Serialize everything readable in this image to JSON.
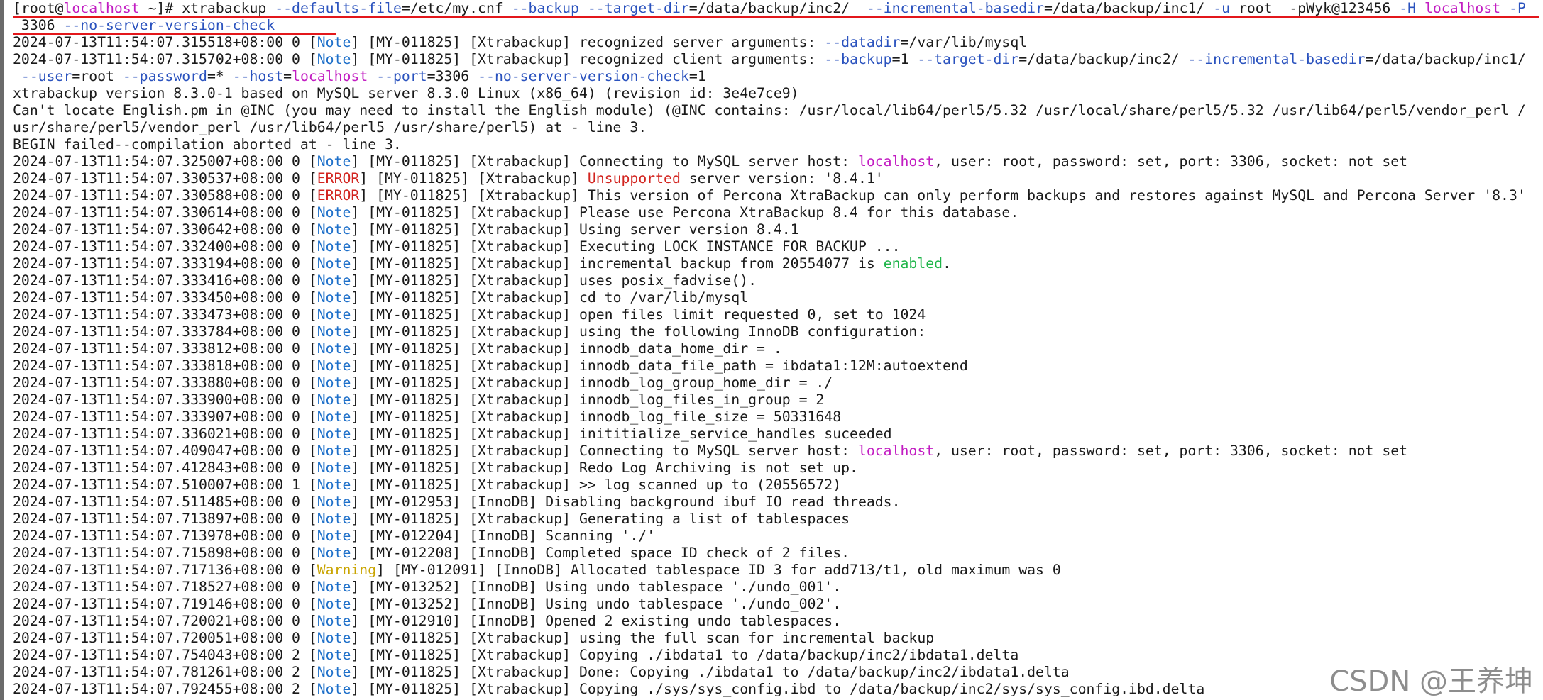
{
  "terminal": {
    "watermark": "CSDN @王养坤",
    "lines": [
      [
        [
          "prompt",
          "[root@"
        ],
        [
          "host",
          "localhost"
        ],
        [
          "prompt",
          " ~]# xtrabackup "
        ],
        [
          "flag",
          "--defaults-file"
        ],
        [
          "plain",
          "=/etc/my.cnf "
        ],
        [
          "flag",
          "--backup --target-dir"
        ],
        [
          "plain",
          "=/data/backup/inc2/  "
        ],
        [
          "flag",
          "--incremental-basedir"
        ],
        [
          "plain",
          "=/data/backup/inc1/ "
        ],
        [
          "flag",
          "-u"
        ],
        [
          "plain",
          " root  -pWyk@123456 "
        ],
        [
          "flag",
          "-H"
        ],
        [
          "plain",
          " "
        ],
        [
          "host",
          "localhost"
        ],
        [
          "plain",
          " "
        ],
        [
          "flag",
          "-P"
        ]
      ],
      [
        [
          "plain",
          " 3306 "
        ],
        [
          "flag",
          "--no-server-version-check"
        ]
      ],
      [
        [
          "plain",
          "2024-07-13T11:54:07.315518+08:00 0 ["
        ],
        [
          "note",
          "Note"
        ],
        [
          "plain",
          "] [MY-011825] [Xtrabackup] recognized server arguments: "
        ],
        [
          "flag",
          "--datadir"
        ],
        [
          "plain",
          "=/var/lib/mysql"
        ]
      ],
      [
        [
          "plain",
          "2024-07-13T11:54:07.315702+08:00 0 ["
        ],
        [
          "note",
          "Note"
        ],
        [
          "plain",
          "] [MY-011825] [Xtrabackup] recognized client arguments: "
        ],
        [
          "flag",
          "--backup"
        ],
        [
          "plain",
          "=1 "
        ],
        [
          "flag",
          "--target-dir"
        ],
        [
          "plain",
          "=/data/backup/inc2/ "
        ],
        [
          "flag",
          "--incremental-basedir"
        ],
        [
          "plain",
          "=/data/backup/inc1/"
        ]
      ],
      [
        [
          "plain",
          " "
        ],
        [
          "flag",
          "--user"
        ],
        [
          "plain",
          "=root "
        ],
        [
          "flag",
          "--password"
        ],
        [
          "plain",
          "=* "
        ],
        [
          "flag",
          "--host"
        ],
        [
          "plain",
          "="
        ],
        [
          "host",
          "localhost"
        ],
        [
          "plain",
          " "
        ],
        [
          "flag",
          "--port"
        ],
        [
          "plain",
          "=3306 "
        ],
        [
          "flag",
          "--no-server-version-check"
        ],
        [
          "plain",
          "=1"
        ]
      ],
      [
        [
          "plain",
          "xtrabackup version 8.3.0-1 based on MySQL server 8.3.0 Linux (x86_64) (revision id: 3e4e7ce9)"
        ]
      ],
      [
        [
          "plain",
          "Can't locate English.pm in @INC (you may need to install the English module) (@INC contains: /usr/local/lib64/perl5/5.32 /usr/local/share/perl5/5.32 /usr/lib64/perl5/vendor_perl /"
        ]
      ],
      [
        [
          "plain",
          "usr/share/perl5/vendor_perl /usr/lib64/perl5 /usr/share/perl5) at - line 3."
        ]
      ],
      [
        [
          "plain",
          "BEGIN failed--compilation aborted at - line 3."
        ]
      ],
      [
        [
          "plain",
          "2024-07-13T11:54:07.325007+08:00 0 ["
        ],
        [
          "note",
          "Note"
        ],
        [
          "plain",
          "] [MY-011825] [Xtrabackup] Connecting to MySQL server host: "
        ],
        [
          "host",
          "localhost"
        ],
        [
          "plain",
          ", user: root, password: set, port: 3306, socket: not set"
        ]
      ],
      [
        [
          "plain",
          "2024-07-13T11:54:07.330537+08:00 0 ["
        ],
        [
          "error",
          "ERROR"
        ],
        [
          "plain",
          "] [MY-011825] [Xtrabackup] "
        ],
        [
          "unsupported",
          "Unsupported"
        ],
        [
          "plain",
          " server version: '8.4.1'"
        ]
      ],
      [
        [
          "plain",
          "2024-07-13T11:54:07.330588+08:00 0 ["
        ],
        [
          "error",
          "ERROR"
        ],
        [
          "plain",
          "] [MY-011825] [Xtrabackup] This version of Percona XtraBackup can only perform backups and restores against MySQL and Percona Server '8.3'"
        ]
      ],
      [
        [
          "plain",
          "2024-07-13T11:54:07.330614+08:00 0 ["
        ],
        [
          "note",
          "Note"
        ],
        [
          "plain",
          "] [MY-011825] [Xtrabackup] Please use Percona XtraBackup 8.4 for this database."
        ]
      ],
      [
        [
          "plain",
          "2024-07-13T11:54:07.330642+08:00 0 ["
        ],
        [
          "note",
          "Note"
        ],
        [
          "plain",
          "] [MY-011825] [Xtrabackup] Using server version 8.4.1"
        ]
      ],
      [
        [
          "plain",
          "2024-07-13T11:54:07.332400+08:00 0 ["
        ],
        [
          "note",
          "Note"
        ],
        [
          "plain",
          "] [MY-011825] [Xtrabackup] Executing LOCK INSTANCE FOR BACKUP ..."
        ]
      ],
      [
        [
          "plain",
          "2024-07-13T11:54:07.333194+08:00 0 ["
        ],
        [
          "note",
          "Note"
        ],
        [
          "plain",
          "] [MY-011825] [Xtrabackup] incremental backup from 20554077 is "
        ],
        [
          "enabled",
          "enabled"
        ],
        [
          "plain",
          "."
        ]
      ],
      [
        [
          "plain",
          "2024-07-13T11:54:07.333416+08:00 0 ["
        ],
        [
          "note",
          "Note"
        ],
        [
          "plain",
          "] [MY-011825] [Xtrabackup] uses posix_fadvise()."
        ]
      ],
      [
        [
          "plain",
          "2024-07-13T11:54:07.333450+08:00 0 ["
        ],
        [
          "note",
          "Note"
        ],
        [
          "plain",
          "] [MY-011825] [Xtrabackup] cd to /var/lib/mysql"
        ]
      ],
      [
        [
          "plain",
          "2024-07-13T11:54:07.333473+08:00 0 ["
        ],
        [
          "note",
          "Note"
        ],
        [
          "plain",
          "] [MY-011825] [Xtrabackup] open files limit requested 0, set to 1024"
        ]
      ],
      [
        [
          "plain",
          "2024-07-13T11:54:07.333784+08:00 0 ["
        ],
        [
          "note",
          "Note"
        ],
        [
          "plain",
          "] [MY-011825] [Xtrabackup] using the following InnoDB configuration:"
        ]
      ],
      [
        [
          "plain",
          "2024-07-13T11:54:07.333812+08:00 0 ["
        ],
        [
          "note",
          "Note"
        ],
        [
          "plain",
          "] [MY-011825] [Xtrabackup] innodb_data_home_dir = ."
        ]
      ],
      [
        [
          "plain",
          "2024-07-13T11:54:07.333818+08:00 0 ["
        ],
        [
          "note",
          "Note"
        ],
        [
          "plain",
          "] [MY-011825] [Xtrabackup] innodb_data_file_path = ibdata1:12M:autoextend"
        ]
      ],
      [
        [
          "plain",
          "2024-07-13T11:54:07.333880+08:00 0 ["
        ],
        [
          "note",
          "Note"
        ],
        [
          "plain",
          "] [MY-011825] [Xtrabackup] innodb_log_group_home_dir = ./"
        ]
      ],
      [
        [
          "plain",
          "2024-07-13T11:54:07.333900+08:00 0 ["
        ],
        [
          "note",
          "Note"
        ],
        [
          "plain",
          "] [MY-011825] [Xtrabackup] innodb_log_files_in_group = 2"
        ]
      ],
      [
        [
          "plain",
          "2024-07-13T11:54:07.333907+08:00 0 ["
        ],
        [
          "note",
          "Note"
        ],
        [
          "plain",
          "] [MY-011825] [Xtrabackup] innodb_log_file_size = 50331648"
        ]
      ],
      [
        [
          "plain",
          "2024-07-13T11:54:07.336021+08:00 0 ["
        ],
        [
          "note",
          "Note"
        ],
        [
          "plain",
          "] [MY-011825] [Xtrabackup] inititialize_service_handles suceeded"
        ]
      ],
      [
        [
          "plain",
          "2024-07-13T11:54:07.409047+08:00 0 ["
        ],
        [
          "note",
          "Note"
        ],
        [
          "plain",
          "] [MY-011825] [Xtrabackup] Connecting to MySQL server host: "
        ],
        [
          "host",
          "localhost"
        ],
        [
          "plain",
          ", user: root, password: set, port: 3306, socket: not set"
        ]
      ],
      [
        [
          "plain",
          "2024-07-13T11:54:07.412843+08:00 0 ["
        ],
        [
          "note",
          "Note"
        ],
        [
          "plain",
          "] [MY-011825] [Xtrabackup] Redo Log Archiving is not set up."
        ]
      ],
      [
        [
          "plain",
          "2024-07-13T11:54:07.510007+08:00 1 ["
        ],
        [
          "note",
          "Note"
        ],
        [
          "plain",
          "] [MY-011825] [Xtrabackup] >> log scanned up to (20556572)"
        ]
      ],
      [
        [
          "plain",
          "2024-07-13T11:54:07.511485+08:00 0 ["
        ],
        [
          "note",
          "Note"
        ],
        [
          "plain",
          "] [MY-012953] [InnoDB] Disabling background ibuf IO read threads."
        ]
      ],
      [
        [
          "plain",
          "2024-07-13T11:54:07.713897+08:00 0 ["
        ],
        [
          "note",
          "Note"
        ],
        [
          "plain",
          "] [MY-011825] [Xtrabackup] Generating a list of tablespaces"
        ]
      ],
      [
        [
          "plain",
          "2024-07-13T11:54:07.713978+08:00 0 ["
        ],
        [
          "note",
          "Note"
        ],
        [
          "plain",
          "] [MY-012204] [InnoDB] Scanning './'"
        ]
      ],
      [
        [
          "plain",
          "2024-07-13T11:54:07.715898+08:00 0 ["
        ],
        [
          "note",
          "Note"
        ],
        [
          "plain",
          "] [MY-012208] [InnoDB] Completed space ID check of 2 files."
        ]
      ],
      [
        [
          "plain",
          "2024-07-13T11:54:07.717136+08:00 0 ["
        ],
        [
          "warning",
          "Warning"
        ],
        [
          "plain",
          "] [MY-012091] [InnoDB] Allocated tablespace ID 3 for add713/t1, old maximum was 0"
        ]
      ],
      [
        [
          "plain",
          "2024-07-13T11:54:07.718527+08:00 0 ["
        ],
        [
          "note",
          "Note"
        ],
        [
          "plain",
          "] [MY-013252] [InnoDB] Using undo tablespace './undo_001'."
        ]
      ],
      [
        [
          "plain",
          "2024-07-13T11:54:07.719146+08:00 0 ["
        ],
        [
          "note",
          "Note"
        ],
        [
          "plain",
          "] [MY-013252] [InnoDB] Using undo tablespace './undo_002'."
        ]
      ],
      [
        [
          "plain",
          "2024-07-13T11:54:07.720021+08:00 0 ["
        ],
        [
          "note",
          "Note"
        ],
        [
          "plain",
          "] [MY-012910] [InnoDB] Opened 2 existing undo tablespaces."
        ]
      ],
      [
        [
          "plain",
          "2024-07-13T11:54:07.720051+08:00 0 ["
        ],
        [
          "note",
          "Note"
        ],
        [
          "plain",
          "] [MY-011825] [Xtrabackup] using the full scan for incremental backup"
        ]
      ],
      [
        [
          "plain",
          "2024-07-13T11:54:07.754043+08:00 2 ["
        ],
        [
          "note",
          "Note"
        ],
        [
          "plain",
          "] [MY-011825] [Xtrabackup] Copying ./ibdata1 to /data/backup/inc2/ibdata1.delta"
        ]
      ],
      [
        [
          "plain",
          "2024-07-13T11:54:07.781261+08:00 2 ["
        ],
        [
          "note",
          "Note"
        ],
        [
          "plain",
          "] [MY-011825] [Xtrabackup] Done: Copying ./ibdata1 to /data/backup/inc2/ibdata1.delta"
        ]
      ],
      [
        [
          "plain",
          "2024-07-13T11:54:07.792455+08:00 2 ["
        ],
        [
          "note",
          "Note"
        ],
        [
          "plain",
          "] [MY-011825] [Xtrabackup] Copying ./sys/sys_config.ibd to /data/backup/inc2/sys/sys_config.ibd.delta"
        ]
      ]
    ]
  },
  "colors": {
    "background": "#ffffff",
    "text": "#1a1a1a",
    "host": "#c21cc2",
    "flag": "#2a52be",
    "note": "#1d6fc9",
    "error": "#d2241f",
    "warning": "#c9a400",
    "enabled": "#1fb54a",
    "underline": "#e3171b"
  }
}
